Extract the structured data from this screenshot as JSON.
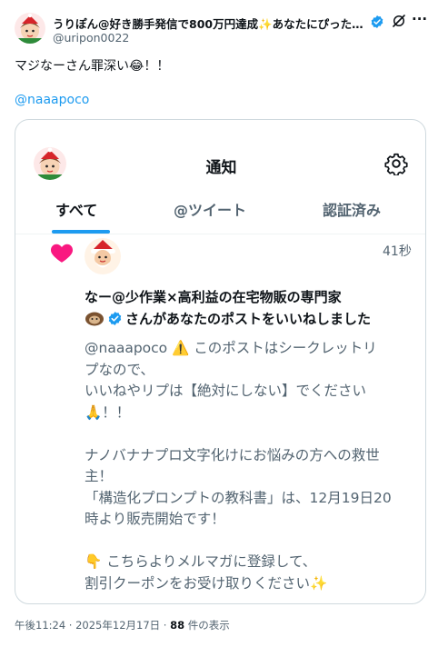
{
  "post": {
    "author_name": "うりぽん@好き勝手発信で800万円達成✨あなたにぴったりの...",
    "author_handle": "@uripon0022",
    "text": "マジなーさん罪深い😂！！",
    "mention": "@naaapoco",
    "timestamp": "午後11:24 · 2025年12月17日 · ",
    "view_count": "88",
    "view_suffix": " 件の表示"
  },
  "card": {
    "title": "通知",
    "tabs": [
      {
        "label": "すべて",
        "active": true
      },
      {
        "label": "@ツイート",
        "active": false
      },
      {
        "label": "認証済み",
        "active": false
      }
    ],
    "notification": {
      "time": "41秒",
      "liker_name": "なー@少作業×高利益の在宅物販の専門家",
      "action_text": "さんがあなたのポストをいいねしました",
      "quoted_lines": [
        "@naaapoco ⚠️ このポストはシークレットリ",
        "プなので、",
        "いいねやリプは【絶対にしない】でください",
        "🙏！！",
        "",
        "ナノバナナプロ文字化けにお悩みの方への救世",
        "主！",
        "「構造化プロンプトの教科書」は、12月19日20",
        "時より販売開始です！",
        "",
        "👇 こちらよりメルマガに登録して、",
        "割引クーポンをお受け取りください✨"
      ]
    }
  },
  "colors": {
    "accent": "#1d9bf0",
    "like": "#f91880",
    "secondary_text": "#536471",
    "border": "#cfd9de"
  },
  "icons": {
    "verified": "verified-badge-icon",
    "grok": "grok-icon",
    "more": "more-icon",
    "settings": "gear-icon",
    "like": "heart-icon"
  }
}
